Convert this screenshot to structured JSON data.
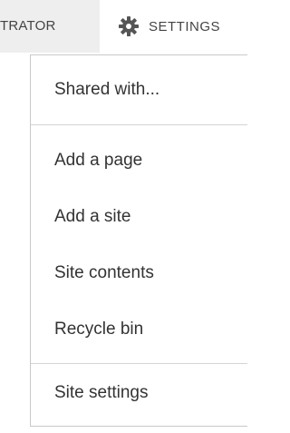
{
  "topbar": {
    "user_label": "TRATOR",
    "settings_label": "SETTINGS",
    "settings_icon": "gear-icon"
  },
  "menu": {
    "groups": [
      {
        "items": [
          {
            "label": "Shared with..."
          }
        ]
      },
      {
        "items": [
          {
            "label": "Add a page"
          },
          {
            "label": "Add a site"
          },
          {
            "label": "Site contents"
          },
          {
            "label": "Recycle bin"
          }
        ]
      },
      {
        "items": [
          {
            "label": "Site settings"
          }
        ]
      }
    ]
  }
}
